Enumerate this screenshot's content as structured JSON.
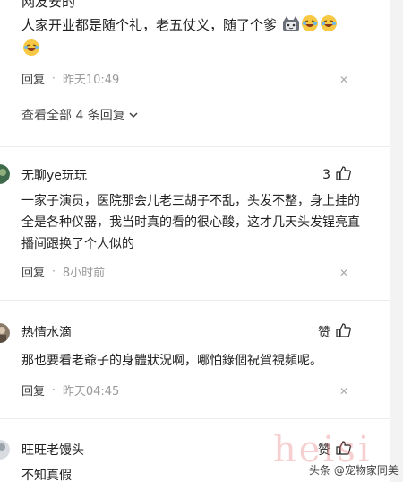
{
  "first_comment": {
    "username": "网友安的",
    "text": "人家开业都是随个礼，老五仗义，随了个爹",
    "emoji": [
      "cat-face-emoji",
      "laughing-face-emoji",
      "laughing-face-emoji",
      "laughing-face-emoji"
    ],
    "reply_label": "回复",
    "time": "昨天10:49",
    "view_all": "查看全部 4 条回复"
  },
  "comments": [
    {
      "username": "无聊ye玩玩",
      "likes": "3",
      "text": "一家子演员，医院那会儿老三胡子不乱，头发不整，身上挂的全是各种仪器，我当时真的看的很心酸，这才几天头发锃亮直播间跟换了个人似的",
      "reply_label": "回复",
      "time": "8小时前"
    },
    {
      "username": "热情水滴",
      "likes": "赞",
      "text": "那也要看老爺子的身體狀況啊，哪怕錄個祝賀視頻呢。",
      "reply_label": "回复",
      "time": "昨天04:45"
    },
    {
      "username": "旺旺老馒头",
      "likes": "赞",
      "text": "不知真假"
    }
  ],
  "watermark": "heisi",
  "source_label": "头条 @宠物家同美",
  "colors": {
    "text": "#222222",
    "meta": "#999999",
    "divider": "#ececec"
  }
}
